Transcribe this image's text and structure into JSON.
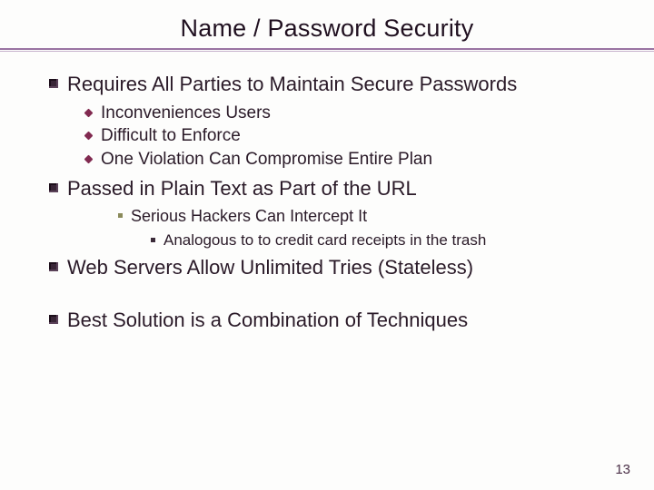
{
  "title": "Name / Password Security",
  "bullets": {
    "b1": "Requires All Parties to Maintain Secure Passwords",
    "b1_sub": {
      "s1": "Inconveniences Users",
      "s2": "Difficult to Enforce",
      "s3": "One Violation Can Compromise Entire Plan"
    },
    "b2": "Passed in Plain Text as Part of the URL",
    "b2_sub": {
      "s1": "Serious Hackers Can Intercept It",
      "s1_sub": {
        "t1": "Analogous to to credit card receipts in the trash"
      }
    },
    "b3": "Web Servers Allow Unlimited Tries (Stateless)",
    "b4": "Best Solution is a Combination of Techniques"
  },
  "page_number": "13"
}
